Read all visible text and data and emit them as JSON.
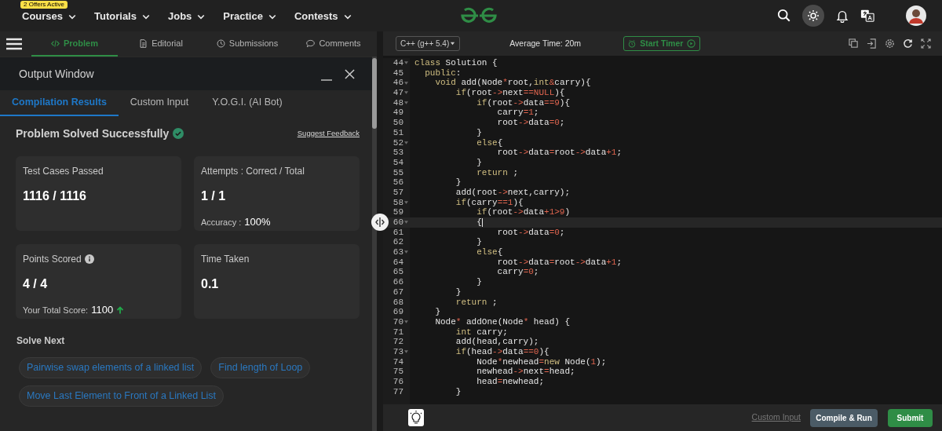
{
  "nav": {
    "offers_badge": "2 Offers Active",
    "items": [
      "Courses",
      "Tutorials",
      "Jobs",
      "Practice",
      "Contests"
    ]
  },
  "problem_tabs": [
    {
      "label": "Problem",
      "kind": "code",
      "selected": true
    },
    {
      "label": "Editorial",
      "kind": "document",
      "selected": false
    },
    {
      "label": "Submissions",
      "kind": "clock",
      "selected": false
    },
    {
      "label": "Comments",
      "kind": "chat",
      "selected": false
    }
  ],
  "output_window": {
    "title": "Output Window",
    "tabs": [
      {
        "label": "Compilation Results",
        "selected": true
      },
      {
        "label": "Custom Input",
        "selected": false
      },
      {
        "label": "Y.O.G.I. (AI Bot)",
        "selected": false
      }
    ],
    "status": "Problem Solved Successfully",
    "feedback_link": "Suggest Feedback",
    "cards": [
      {
        "label": "Test Cases Passed",
        "value": "1116 / 1116",
        "info": false
      },
      {
        "label": "Attempts : Correct / Total",
        "value": "1 / 1",
        "info": false,
        "detail_label": "Accuracy :",
        "detail_value": "100%"
      },
      {
        "label": "Points Scored",
        "value": "4 / 4",
        "info": true,
        "detail_label": "Your Total Score:",
        "detail_value": "1100",
        "rising": true
      },
      {
        "label": "Time Taken",
        "value": "0.1",
        "info": false
      }
    ],
    "solve_next": {
      "title": "Solve Next",
      "links": [
        "Pairwise swap elements of a linked list",
        "Find length of Loop",
        "Move Last Element to Front of a Linked List"
      ]
    }
  },
  "editor": {
    "language": "C++ (g++ 5.4)",
    "average_time": "Average Time: 20m",
    "timer_button": "Start Timer",
    "lines": [
      {
        "number": "44",
        "fold": true,
        "current": false,
        "segments": [
          {
            "kind": "keyword",
            "text": "class"
          },
          {
            "kind": "plain",
            "text": " Solution {"
          }
        ]
      },
      {
        "number": "45",
        "fold": false,
        "current": false,
        "segments": [
          {
            "kind": "keyword",
            "text": "  public"
          },
          {
            "kind": "plain",
            "text": ":"
          }
        ]
      },
      {
        "number": "46",
        "fold": true,
        "current": false,
        "segments": [
          {
            "kind": "keyword",
            "text": "    void"
          },
          {
            "kind": "plain",
            "text": " add(Node"
          },
          {
            "kind": "operator",
            "text": "*"
          },
          {
            "kind": "plain",
            "text": "root,"
          },
          {
            "kind": "keyword",
            "text": "int"
          },
          {
            "kind": "operator",
            "text": "&"
          },
          {
            "kind": "plain",
            "text": "carry){"
          }
        ]
      },
      {
        "number": "47",
        "fold": true,
        "current": false,
        "segments": [
          {
            "kind": "keyword",
            "text": "        if"
          },
          {
            "kind": "plain",
            "text": "(root"
          },
          {
            "kind": "operator",
            "text": "->"
          },
          {
            "kind": "plain",
            "text": "next"
          },
          {
            "kind": "operator",
            "text": "==NULL"
          },
          {
            "kind": "plain",
            "text": "){"
          }
        ]
      },
      {
        "number": "48",
        "fold": true,
        "current": false,
        "segments": [
          {
            "kind": "keyword",
            "text": "            if"
          },
          {
            "kind": "plain",
            "text": "(root"
          },
          {
            "kind": "operator",
            "text": "->"
          },
          {
            "kind": "plain",
            "text": "data"
          },
          {
            "kind": "operator",
            "text": "==9"
          },
          {
            "kind": "plain",
            "text": "){"
          }
        ]
      },
      {
        "number": "49",
        "fold": false,
        "current": false,
        "segments": [
          {
            "kind": "plain",
            "text": "                carry"
          },
          {
            "kind": "operator",
            "text": "=1"
          },
          {
            "kind": "plain",
            "text": ";"
          }
        ]
      },
      {
        "number": "50",
        "fold": false,
        "current": false,
        "segments": [
          {
            "kind": "plain",
            "text": "                root"
          },
          {
            "kind": "operator",
            "text": "->"
          },
          {
            "kind": "plain",
            "text": "data"
          },
          {
            "kind": "operator",
            "text": "=0"
          },
          {
            "kind": "plain",
            "text": ";"
          }
        ]
      },
      {
        "number": "51",
        "fold": false,
        "current": false,
        "segments": [
          {
            "kind": "plain",
            "text": "            }"
          }
        ]
      },
      {
        "number": "52",
        "fold": true,
        "current": false,
        "segments": [
          {
            "kind": "keyword",
            "text": "            else"
          },
          {
            "kind": "plain",
            "text": "{"
          }
        ]
      },
      {
        "number": "53",
        "fold": false,
        "current": false,
        "segments": [
          {
            "kind": "plain",
            "text": "                root"
          },
          {
            "kind": "operator",
            "text": "->"
          },
          {
            "kind": "plain",
            "text": "data"
          },
          {
            "kind": "operator",
            "text": "="
          },
          {
            "kind": "plain",
            "text": "root"
          },
          {
            "kind": "operator",
            "text": "->"
          },
          {
            "kind": "plain",
            "text": "data"
          },
          {
            "kind": "operator",
            "text": "+1"
          },
          {
            "kind": "plain",
            "text": ";"
          }
        ]
      },
      {
        "number": "54",
        "fold": false,
        "current": false,
        "segments": [
          {
            "kind": "plain",
            "text": "            }"
          }
        ]
      },
      {
        "number": "55",
        "fold": false,
        "current": false,
        "segments": [
          {
            "kind": "keyword",
            "text": "            return"
          },
          {
            "kind": "plain",
            "text": " ;"
          }
        ]
      },
      {
        "number": "56",
        "fold": false,
        "current": false,
        "segments": [
          {
            "kind": "plain",
            "text": "        }"
          }
        ]
      },
      {
        "number": "57",
        "fold": false,
        "current": false,
        "segments": [
          {
            "kind": "plain",
            "text": "        add(root"
          },
          {
            "kind": "operator",
            "text": "->"
          },
          {
            "kind": "plain",
            "text": "next,carry);"
          }
        ]
      },
      {
        "number": "58",
        "fold": true,
        "current": false,
        "segments": [
          {
            "kind": "keyword",
            "text": "        if"
          },
          {
            "kind": "plain",
            "text": "(carry"
          },
          {
            "kind": "operator",
            "text": "==1"
          },
          {
            "kind": "plain",
            "text": "){"
          }
        ]
      },
      {
        "number": "59",
        "fold": false,
        "current": false,
        "segments": [
          {
            "kind": "keyword",
            "text": "            if"
          },
          {
            "kind": "plain",
            "text": "(root"
          },
          {
            "kind": "operator",
            "text": "->"
          },
          {
            "kind": "plain",
            "text": "data"
          },
          {
            "kind": "operator",
            "text": "+1>9"
          },
          {
            "kind": "plain",
            "text": ")"
          }
        ]
      },
      {
        "number": "60",
        "fold": true,
        "current": true,
        "segments": [
          {
            "kind": "plain",
            "text": "            {"
          }
        ]
      },
      {
        "number": "61",
        "fold": false,
        "current": false,
        "segments": [
          {
            "kind": "plain",
            "text": "                root"
          },
          {
            "kind": "operator",
            "text": "->"
          },
          {
            "kind": "plain",
            "text": "data"
          },
          {
            "kind": "operator",
            "text": "=0"
          },
          {
            "kind": "plain",
            "text": ";"
          }
        ]
      },
      {
        "number": "62",
        "fold": false,
        "current": false,
        "segments": [
          {
            "kind": "plain",
            "text": "            }"
          }
        ]
      },
      {
        "number": "63",
        "fold": true,
        "current": false,
        "segments": [
          {
            "kind": "keyword",
            "text": "            else"
          },
          {
            "kind": "plain",
            "text": "{"
          }
        ]
      },
      {
        "number": "64",
        "fold": false,
        "current": false,
        "segments": [
          {
            "kind": "plain",
            "text": "                root"
          },
          {
            "kind": "operator",
            "text": "->"
          },
          {
            "kind": "plain",
            "text": "data"
          },
          {
            "kind": "operator",
            "text": "="
          },
          {
            "kind": "plain",
            "text": "root"
          },
          {
            "kind": "operator",
            "text": "->"
          },
          {
            "kind": "plain",
            "text": "data"
          },
          {
            "kind": "operator",
            "text": "+1"
          },
          {
            "kind": "plain",
            "text": ";"
          }
        ]
      },
      {
        "number": "65",
        "fold": false,
        "current": false,
        "segments": [
          {
            "kind": "plain",
            "text": "                carry"
          },
          {
            "kind": "operator",
            "text": "=0"
          },
          {
            "kind": "plain",
            "text": ";"
          }
        ]
      },
      {
        "number": "66",
        "fold": false,
        "current": false,
        "segments": [
          {
            "kind": "plain",
            "text": "            }"
          }
        ]
      },
      {
        "number": "67",
        "fold": false,
        "current": false,
        "segments": [
          {
            "kind": "plain",
            "text": "        }"
          }
        ]
      },
      {
        "number": "68",
        "fold": false,
        "current": false,
        "segments": [
          {
            "kind": "keyword",
            "text": "        return"
          },
          {
            "kind": "plain",
            "text": " ;"
          }
        ]
      },
      {
        "number": "69",
        "fold": false,
        "current": false,
        "segments": [
          {
            "kind": "plain",
            "text": "    }"
          }
        ]
      },
      {
        "number": "70",
        "fold": true,
        "current": false,
        "segments": [
          {
            "kind": "plain",
            "text": "    Node"
          },
          {
            "kind": "operator",
            "text": "*"
          },
          {
            "kind": "plain",
            "text": " addOne(Node"
          },
          {
            "kind": "operator",
            "text": "*"
          },
          {
            "kind": "plain",
            "text": " head) {"
          }
        ]
      },
      {
        "number": "71",
        "fold": false,
        "current": false,
        "segments": [
          {
            "kind": "keyword",
            "text": "        int"
          },
          {
            "kind": "plain",
            "text": " carry;"
          }
        ]
      },
      {
        "number": "72",
        "fold": false,
        "current": false,
        "segments": [
          {
            "kind": "plain",
            "text": "        add(head,carry);"
          }
        ]
      },
      {
        "number": "73",
        "fold": true,
        "current": false,
        "segments": [
          {
            "kind": "keyword",
            "text": "        if"
          },
          {
            "kind": "plain",
            "text": "(head"
          },
          {
            "kind": "operator",
            "text": "->"
          },
          {
            "kind": "plain",
            "text": "data"
          },
          {
            "kind": "operator",
            "text": "==0"
          },
          {
            "kind": "plain",
            "text": "){"
          }
        ]
      },
      {
        "number": "74",
        "fold": false,
        "current": false,
        "segments": [
          {
            "kind": "plain",
            "text": "            Node"
          },
          {
            "kind": "operator",
            "text": "*"
          },
          {
            "kind": "plain",
            "text": "newhead"
          },
          {
            "kind": "operator",
            "text": "="
          },
          {
            "kind": "keyword",
            "text": "new"
          },
          {
            "kind": "plain",
            "text": " Node("
          },
          {
            "kind": "operator",
            "text": "1"
          },
          {
            "kind": "plain",
            "text": ");"
          }
        ]
      },
      {
        "number": "75",
        "fold": false,
        "current": false,
        "segments": [
          {
            "kind": "plain",
            "text": "            newhead"
          },
          {
            "kind": "operator",
            "text": "->"
          },
          {
            "kind": "plain",
            "text": "next"
          },
          {
            "kind": "operator",
            "text": "="
          },
          {
            "kind": "plain",
            "text": "head;"
          }
        ]
      },
      {
        "number": "76",
        "fold": false,
        "current": false,
        "segments": [
          {
            "kind": "plain",
            "text": "            head"
          },
          {
            "kind": "operator",
            "text": "="
          },
          {
            "kind": "plain",
            "text": "newhead;"
          }
        ]
      },
      {
        "number": "77",
        "fold": false,
        "current": false,
        "segments": [
          {
            "kind": "plain",
            "text": "        }"
          }
        ]
      }
    ]
  },
  "footer": {
    "custom_input": "Custom Input",
    "compile_button": "Compile & Run",
    "submit_button": "Submit"
  }
}
